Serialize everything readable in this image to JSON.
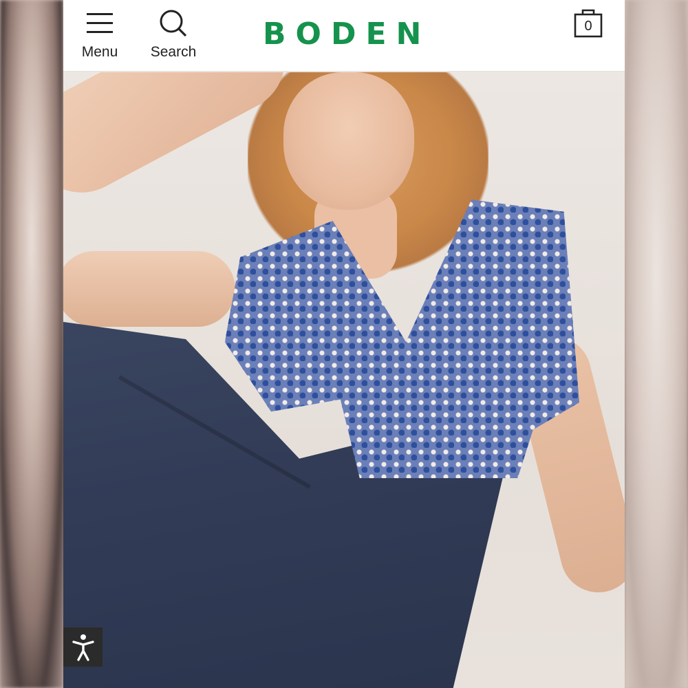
{
  "header": {
    "menu_label": "Menu",
    "search_label": "Search",
    "logo_text": "BODEN",
    "bag_count": "0"
  },
  "colors": {
    "brand_green": "#15924c",
    "header_bg": "#ffffff"
  },
  "icons": {
    "menu": "hamburger-icon",
    "search": "search-icon",
    "bag": "shopping-bag-icon",
    "accessibility": "accessibility-icon"
  },
  "product_image": {
    "alt": "Model wearing blue geometric print wrap top and navy wide-leg trousers"
  }
}
